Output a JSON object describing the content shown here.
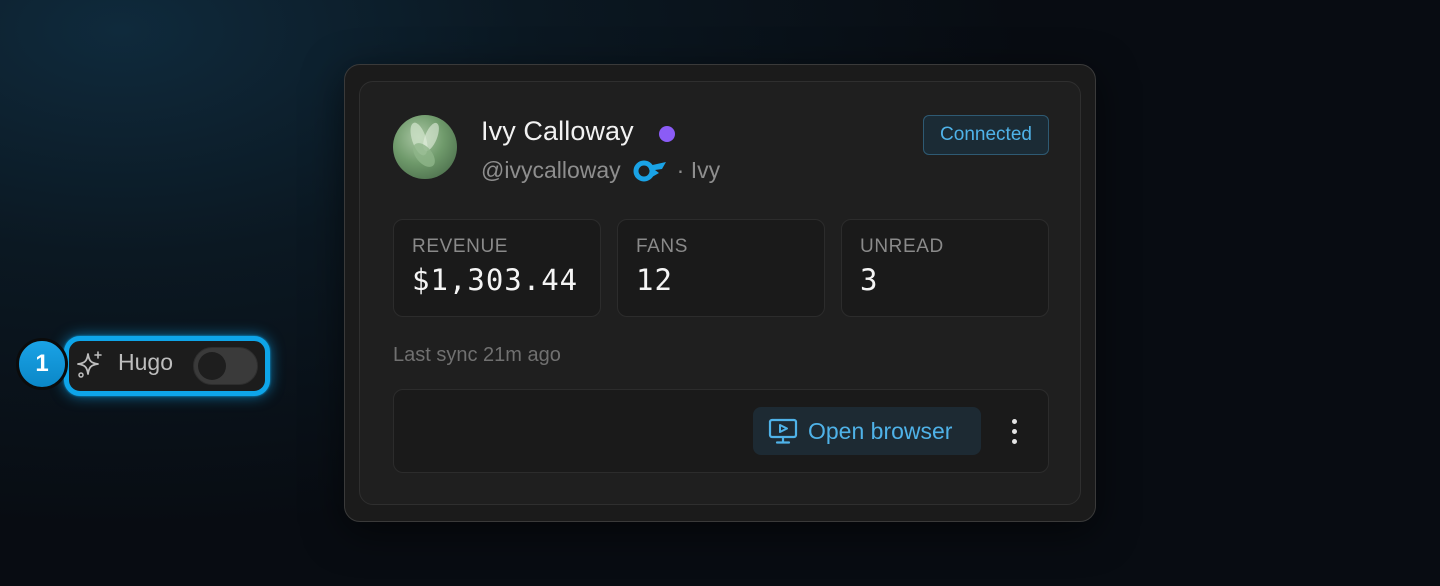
{
  "profile": {
    "name": "Ivy Calloway",
    "handle": "@ivycalloway",
    "display_suffix": "· Ivy",
    "status_color": "#8b5cf6",
    "platform_icon": "onlyfans-logo-icon"
  },
  "connection": {
    "label": "Connected",
    "color": "#4fb2e8"
  },
  "stats": [
    {
      "label": "REVENUE",
      "value": "$1,303.44"
    },
    {
      "label": "FANS",
      "value": "12"
    },
    {
      "label": "UNREAD",
      "value": "3"
    }
  ],
  "sync": {
    "text": "Last sync 21m ago"
  },
  "actions": {
    "hugo_label": "Hugo",
    "hugo_icon": "sparkles-icon",
    "hugo_enabled": false,
    "step_number": "1",
    "open_browser_label": "Open browser",
    "open_browser_icon": "monitor-play-icon",
    "more_icon": "more-vertical-icon"
  },
  "colors": {
    "accent": "#0ea5e9",
    "link": "#4fb2e8"
  }
}
